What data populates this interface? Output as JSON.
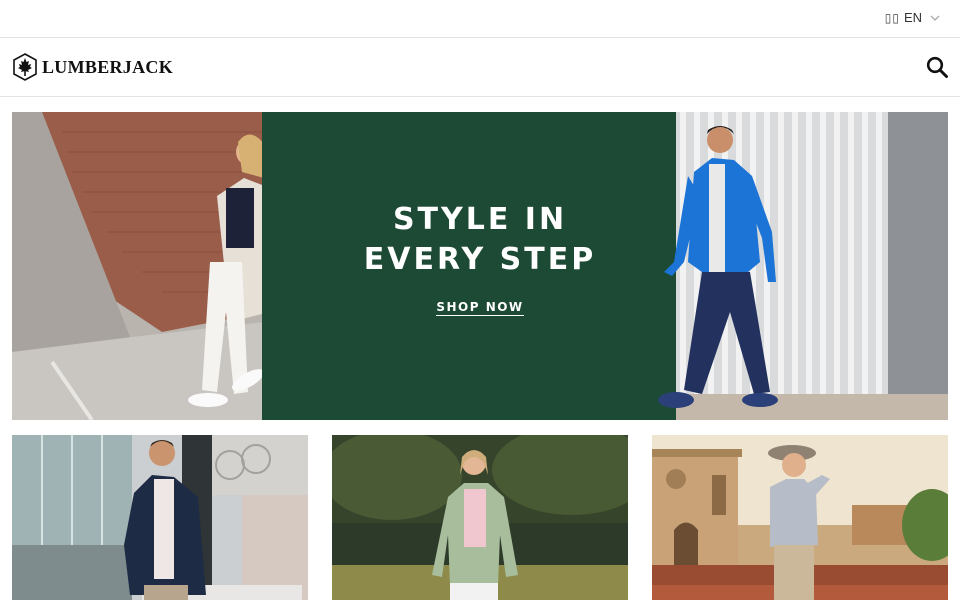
{
  "topbar": {
    "language": {
      "flag_glyph": "▯▯",
      "code": "EN"
    }
  },
  "header": {
    "brand": "LUMBERJACK",
    "logo_icon": "maple-leaf-icon",
    "search_icon": "search-icon"
  },
  "hero": {
    "headline_line1": "STYLE IN",
    "headline_line2": "EVERY STEP",
    "cta": "SHOP NOW",
    "colors": {
      "panel": "#1d4a35",
      "text": "#ffffff"
    }
  },
  "tiles": [
    {
      "id": "men"
    },
    {
      "id": "women"
    },
    {
      "id": "kids"
    }
  ]
}
